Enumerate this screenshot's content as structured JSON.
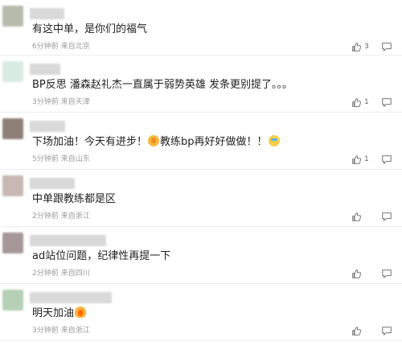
{
  "comments": [
    {
      "text": "有这中单，是你们的福气",
      "time": "6分钟前",
      "location": "来自北京",
      "likes": "3",
      "avatar_color": "#b7bcaa",
      "username_width": 43
    },
    {
      "text": "BP反思 潘森赵礼杰一直属于弱势英雄 发条更别提了。。。",
      "time": "3分钟前",
      "location": "来自天津",
      "likes": "1",
      "avatar_color": "#d9ece4",
      "username_width": 38
    },
    {
      "text_a": "下场加油！今天有进步！",
      "emoji_a": "clap-emoji",
      "text_b": "教练bp再好好做做！！",
      "emoji_b": "crying-face-emoji",
      "time": "5分钟前",
      "location": "来自山东",
      "likes": "1",
      "avatar_color": "#8e8077",
      "username_width": 44
    },
    {
      "text": "中单跟教练都是区",
      "time": "2分钟前",
      "location": "来自浙江",
      "likes": "",
      "avatar_color": "#c8b7b3",
      "username_width": 56
    },
    {
      "text": "ad站位问题，纪律性再提一下",
      "time": "2分钟前",
      "location": "来自四川",
      "likes": "",
      "avatar_color": "#a69898",
      "username_width": 95
    },
    {
      "text_a": "明天加油",
      "emoji_a": "fire-emoji",
      "time": "3分钟前",
      "location": "来自浙江",
      "likes": "",
      "avatar_color": "#b6d0b5",
      "username_width": 102
    }
  ]
}
